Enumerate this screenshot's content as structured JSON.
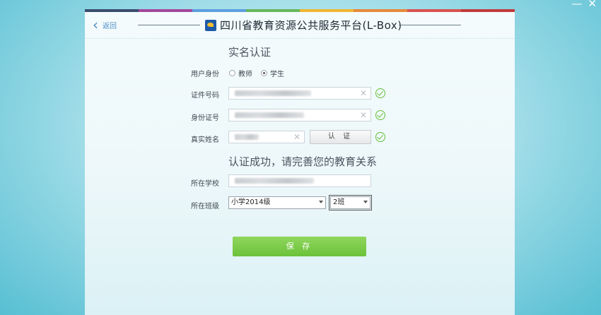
{
  "window": {
    "minimize": "—",
    "close": "✕"
  },
  "colors": {
    "strip": [
      "#3a4d6e",
      "#a3479b",
      "#5d9ee0",
      "#66b85a",
      "#f0b632",
      "#e68a3c",
      "#d9534f",
      "#c13a3a"
    ],
    "accent": "#6cc23a"
  },
  "header": {
    "back_label": "返回",
    "title": "四川省教育资源公共服务平台(L-Box)"
  },
  "verify": {
    "title": "实名认证",
    "identity_label": "用户身份",
    "identity_options": [
      "教师",
      "学生"
    ],
    "identity_selected": "学生",
    "cert_label": "证件号码",
    "id_label": "身份证号",
    "name_label": "真实姓名",
    "verify_button": "认 证"
  },
  "relation": {
    "title": "认证成功，请完善您的教育关系",
    "school_label": "所在学校",
    "class_label": "所在班级",
    "grade_value": "小学2014级",
    "class_value": "2班"
  },
  "save_button": "保 存"
}
